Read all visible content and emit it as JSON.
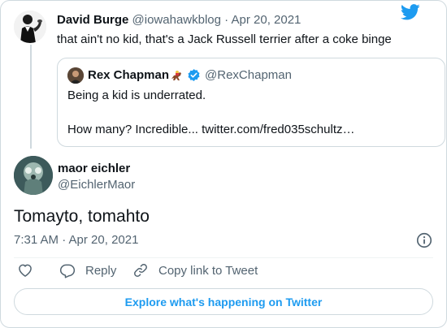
{
  "parent_tweet": {
    "author_name": "David Burge",
    "handle": "@iowahawkblog",
    "separator": "·",
    "date": "Apr 20, 2021",
    "text": "that ain't no kid, that's a Jack Russell terrier after a coke binge"
  },
  "quoted_tweet": {
    "author_name": "Rex Chapman",
    "handle": "@RexChapman",
    "line1": "Being a kid is underrated.",
    "line2": "How many? Incredible... twitter.com/fred035schultz…"
  },
  "main_tweet": {
    "author_name": "maor eichler",
    "handle": "@EichlerMaor",
    "text": "Tomayto, tomahto",
    "timestamp": "7:31 AM · Apr 20, 2021"
  },
  "actions": {
    "like_label": "",
    "reply_label": "Reply",
    "copy_link_label": "Copy link to Tweet"
  },
  "footer": {
    "explore_label": "Explore what's happening on Twitter"
  },
  "colors": {
    "twitter_blue": "#1d9bf0",
    "secondary_text": "#536471",
    "border": "#cfd9de"
  },
  "icons": [
    "twitter-bird-icon",
    "verified-badge-icon",
    "horse-racing-emoji-icon",
    "info-icon",
    "heart-icon",
    "reply-icon",
    "link-icon"
  ]
}
